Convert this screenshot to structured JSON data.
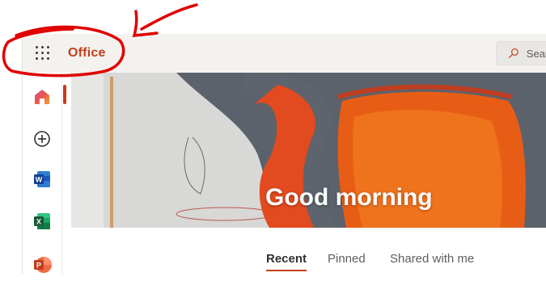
{
  "header": {
    "app_name": "Office",
    "search_placeholder": "Search"
  },
  "sidebar": {
    "items": [
      {
        "icon": "home-icon",
        "active": true
      },
      {
        "icon": "create-icon"
      },
      {
        "icon": "word-icon",
        "letter": "W"
      },
      {
        "icon": "excel-icon",
        "letter": "X"
      },
      {
        "icon": "powerpoint-icon",
        "letter": "P"
      }
    ]
  },
  "hero": {
    "greeting": "Good morning"
  },
  "tabs": [
    {
      "label": "Recent",
      "active": true
    },
    {
      "label": "Pinned"
    },
    {
      "label": "Shared with me"
    }
  ],
  "colors": {
    "accent": "#c43e1c",
    "header_bg": "#f4f2ef",
    "annotation": "#e00000"
  }
}
